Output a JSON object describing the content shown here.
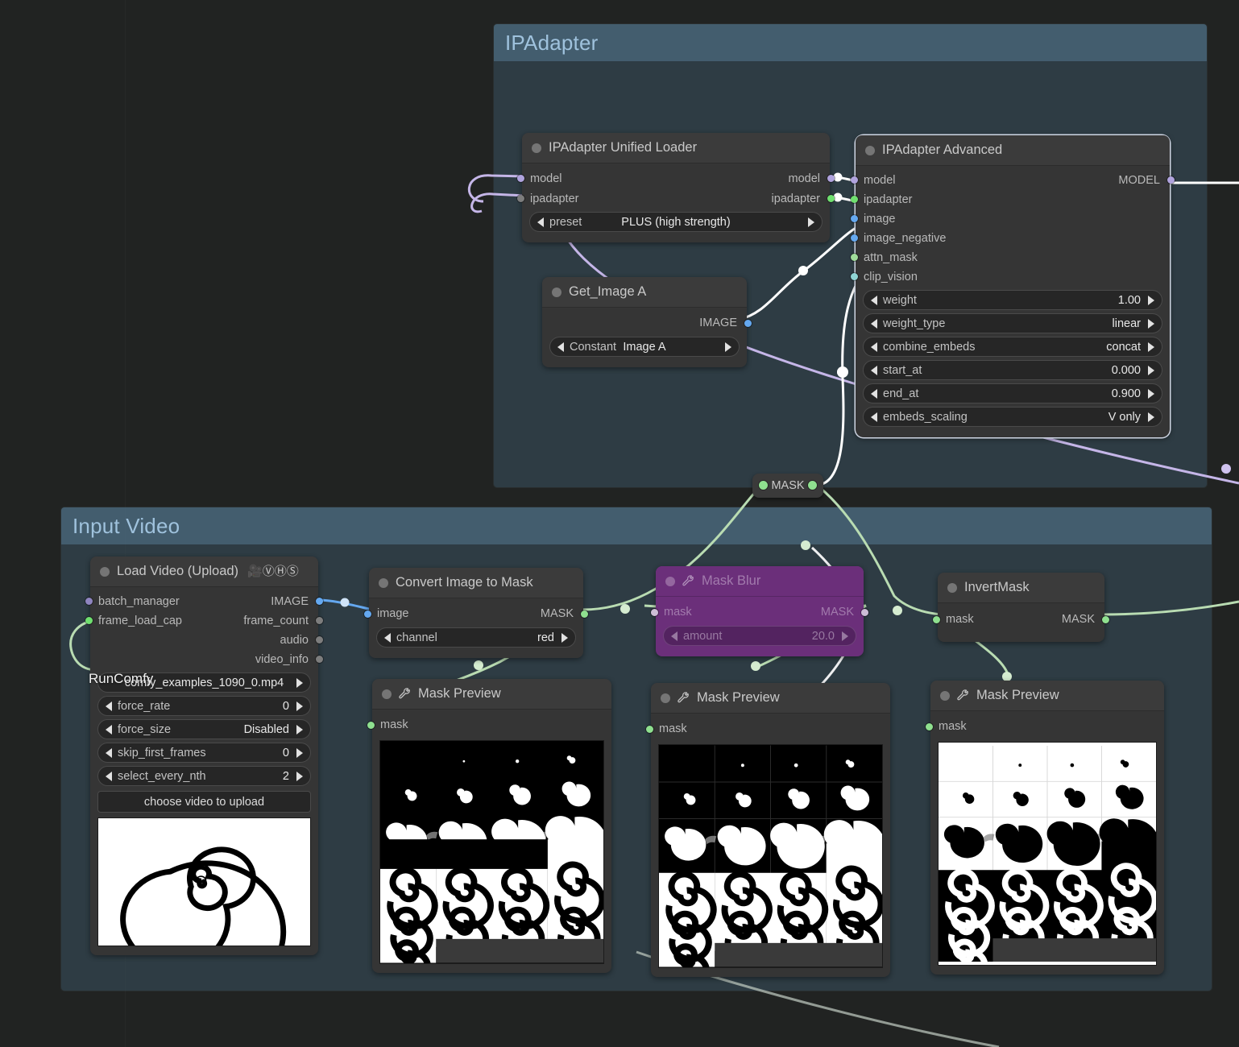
{
  "canvas": {
    "background": "#212322",
    "link_colors": {
      "model": "#c5b6e8",
      "image": "#ffffff",
      "mask": "#b9dcb2",
      "default": "#e8e8e8"
    }
  },
  "groups": [
    {
      "title": "IPAdapter",
      "color": "#9fc2dd"
    },
    {
      "title": "Input Video",
      "color": "#9fc2dd"
    }
  ],
  "nodes": {
    "ipadapter_unified_loader": {
      "title": "IPAdapter Unified Loader",
      "inputs": [
        {
          "name": "model",
          "color": "#b0a3de"
        },
        {
          "name": "ipadapter",
          "color": "#7d7d7d"
        }
      ],
      "outputs": [
        {
          "name": "model",
          "color": "#b0a3de"
        },
        {
          "name": "ipadapter",
          "color": "#6fe06f"
        }
      ],
      "widgets": [
        {
          "name": "preset",
          "value": "PLUS (high strength)"
        }
      ]
    },
    "get_image_a": {
      "title": "Get_Image A",
      "inputs": [],
      "outputs": [
        {
          "name": "IMAGE",
          "color": "#64a8f0"
        }
      ],
      "widgets": [
        {
          "name": "Constant",
          "value": "Image A"
        }
      ]
    },
    "ipadapter_advanced": {
      "title": "IPAdapter Advanced",
      "selected": true,
      "inputs": [
        {
          "name": "model",
          "color": "#b0a3de"
        },
        {
          "name": "ipadapter",
          "color": "#6fe06f"
        },
        {
          "name": "image",
          "color": "#64a8f0"
        },
        {
          "name": "image_negative",
          "color": "#64a8f0"
        },
        {
          "name": "attn_mask",
          "color": "#9fdc9a"
        },
        {
          "name": "clip_vision",
          "color": "#8fd4d4"
        }
      ],
      "outputs": [
        {
          "name": "MODEL",
          "color": "#b0a3de"
        }
      ],
      "widgets": [
        {
          "name": "weight",
          "value": "1.00"
        },
        {
          "name": "weight_type",
          "value": "linear"
        },
        {
          "name": "combine_embeds",
          "value": "concat"
        },
        {
          "name": "start_at",
          "value": "0.000"
        },
        {
          "name": "end_at",
          "value": "0.900"
        },
        {
          "name": "embeds_scaling",
          "value": "V only"
        }
      ]
    },
    "mask_reroute": {
      "title": "MASK",
      "dot_color": "#8fe08f"
    },
    "load_video": {
      "title": "Load Video (Upload)",
      "badges": [
        "🎥",
        "Ⓥ",
        "Ⓗ",
        "Ⓢ"
      ],
      "inputs": [
        {
          "name": "batch_manager",
          "color": "#8f85c0"
        },
        {
          "name": "frame_load_cap",
          "color": "#6fe06f"
        }
      ],
      "outputs": [
        {
          "name": "IMAGE",
          "color": "#64a8f0"
        },
        {
          "name": "frame_count",
          "color": "#7d7d7d"
        },
        {
          "name": "audio",
          "color": "#7d7d7d"
        },
        {
          "name": "video_info",
          "color": "#7d7d7d"
        }
      ],
      "widgets": [
        {
          "name": "",
          "value": "comfy_examples_1090_0.mp4",
          "center": true
        },
        {
          "name": "force_rate",
          "value": "0"
        },
        {
          "name": "force_size",
          "value": "Disabled"
        },
        {
          "name": "skip_first_frames",
          "value": "0"
        },
        {
          "name": "select_every_nth",
          "value": "2"
        }
      ],
      "button": "choose video to upload",
      "watermark": "RunComfy"
    },
    "convert_image_to_mask": {
      "title": "Convert Image to Mask",
      "inputs": [
        {
          "name": "image",
          "color": "#64a8f0"
        }
      ],
      "outputs": [
        {
          "name": "MASK",
          "color": "#8fe08f"
        }
      ],
      "widgets": [
        {
          "name": "channel",
          "value": "red"
        }
      ]
    },
    "mask_blur": {
      "title": "Mask Blur",
      "muted": true,
      "inputs": [
        {
          "name": "mask",
          "color": "#cdbdd6"
        }
      ],
      "outputs": [
        {
          "name": "MASK",
          "color": "#cdbdd6"
        }
      ],
      "widgets": [
        {
          "name": "amount",
          "value": "20.0"
        }
      ]
    },
    "invert_mask": {
      "title": "InvertMask",
      "inputs": [
        {
          "name": "mask",
          "color": "#8fe08f"
        }
      ],
      "outputs": [
        {
          "name": "MASK",
          "color": "#8fe08f"
        }
      ]
    },
    "mask_preview_1": {
      "title": "Mask Preview",
      "inputs": [
        {
          "name": "mask",
          "color": "#8fe08f"
        }
      ],
      "preview": "mask-grid-black"
    },
    "mask_preview_2": {
      "title": "Mask Preview",
      "inputs": [
        {
          "name": "mask",
          "color": "#8fe08f"
        }
      ],
      "preview": "mask-grid-black"
    },
    "mask_preview_3": {
      "title": "Mask Preview",
      "inputs": [
        {
          "name": "mask",
          "color": "#8fe08f"
        }
      ],
      "preview": "mask-grid-white"
    }
  }
}
